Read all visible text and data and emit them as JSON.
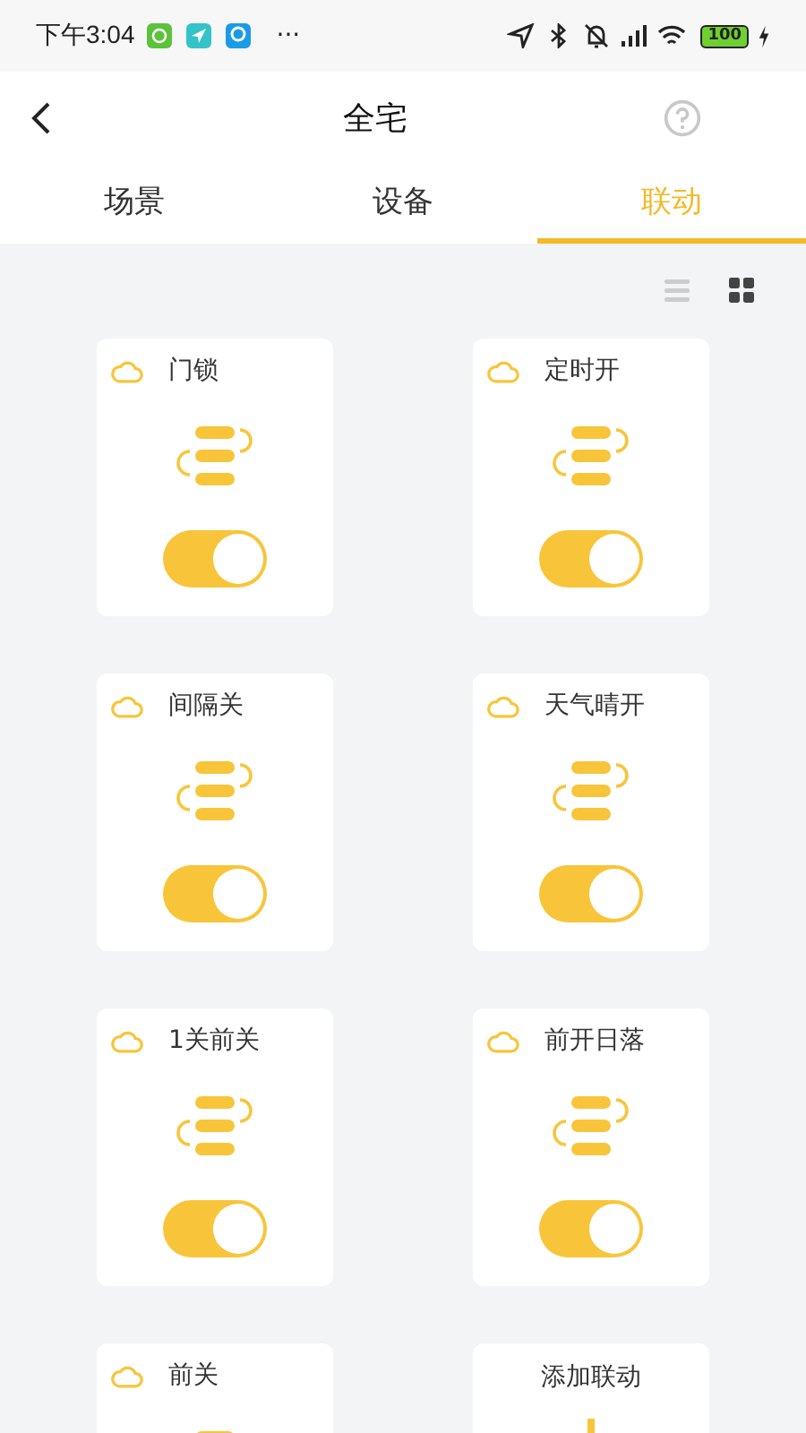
{
  "status_bar": {
    "time": "下午3:04",
    "more": "···",
    "battery": "100"
  },
  "header": {
    "title": "全宅"
  },
  "tabs": [
    {
      "label": "场景",
      "selected": false
    },
    {
      "label": "设备",
      "selected": false
    },
    {
      "label": "联动",
      "selected": true
    }
  ],
  "view_modes": [
    {
      "kind": "list",
      "selected": false
    },
    {
      "kind": "grid",
      "selected": true
    }
  ],
  "cards": [
    {
      "kind": "linkage",
      "title": "门锁",
      "on": true
    },
    {
      "kind": "linkage",
      "title": "定时开",
      "on": true
    },
    {
      "kind": "linkage",
      "title": "间隔关",
      "on": true
    },
    {
      "kind": "linkage",
      "title": "天气晴开",
      "on": true
    },
    {
      "kind": "linkage",
      "title": "1关前关",
      "on": true
    },
    {
      "kind": "linkage",
      "title": "前开日落",
      "on": true
    },
    {
      "kind": "linkage",
      "title": "前关"
    },
    {
      "kind": "add",
      "title": "添加联动"
    }
  ]
}
